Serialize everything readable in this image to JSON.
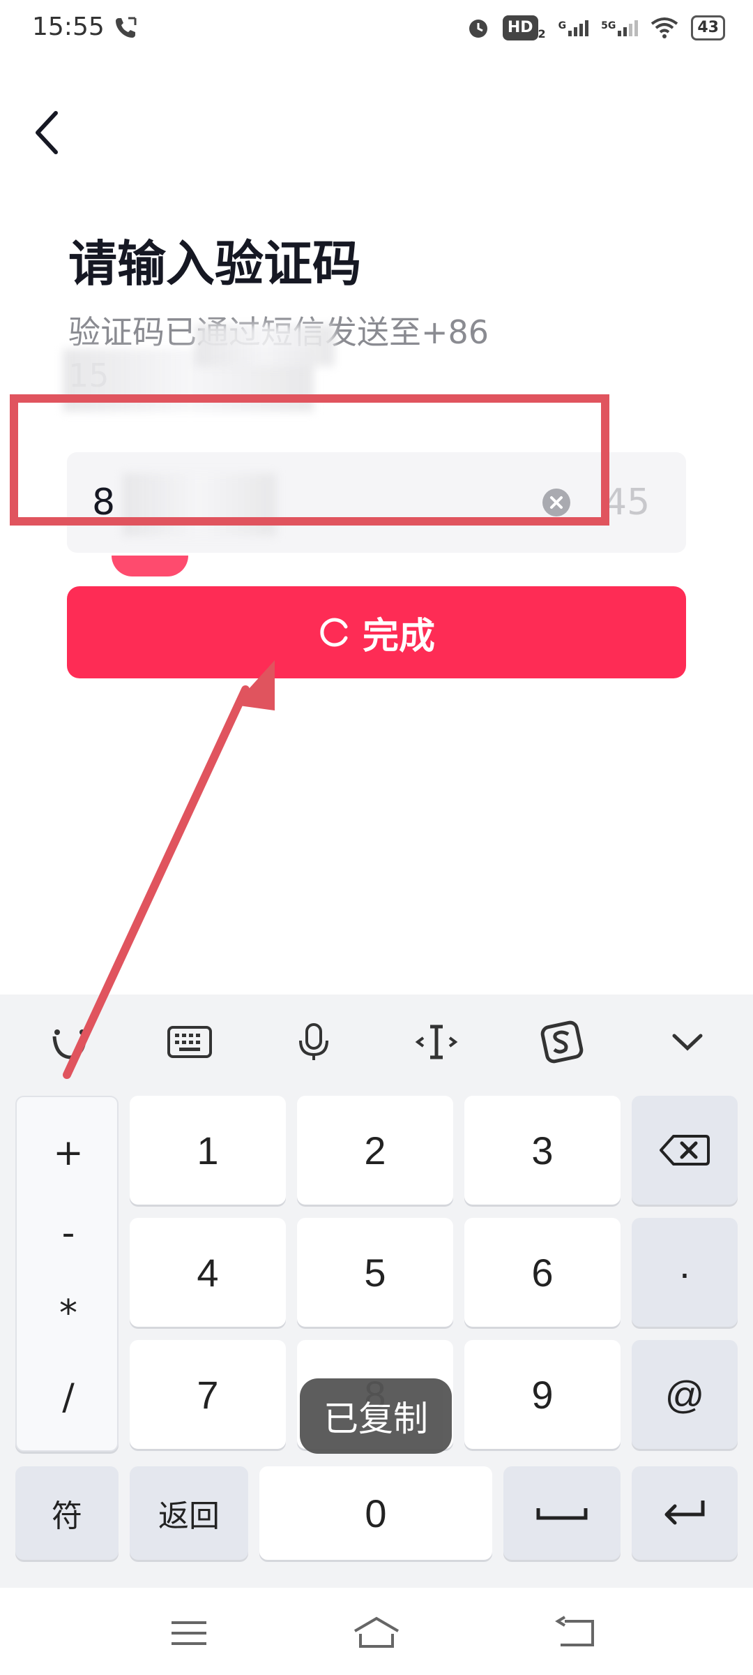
{
  "status_bar": {
    "time": "15:55",
    "hd_badge": "HD",
    "hd_sub": "2",
    "signal1_label": "G",
    "signal2_label": "5G",
    "battery": "43",
    "icons": [
      "phone-call-icon",
      "alarm-icon",
      "wifi-icon",
      "battery-icon"
    ]
  },
  "header": {
    "title": "请输入验证码",
    "subtitle_line1": "验证码已通过短信发送至+86",
    "subtitle_line2": "15"
  },
  "code_input": {
    "value": "8",
    "countdown": "45"
  },
  "done_button": {
    "label": "完成"
  },
  "keyboard": {
    "toolbar": [
      "emoji-icon",
      "keyboard-icon",
      "microphone-icon",
      "cursor-icon",
      "sogou-icon",
      "collapse-chevron-icon"
    ],
    "symbols": [
      "+",
      "-",
      "*",
      "/"
    ],
    "digits": [
      "1",
      "2",
      "3",
      "4",
      "5",
      "6",
      "7",
      "8",
      "9",
      "0"
    ],
    "dot": "·",
    "at": "@",
    "symbol_key": "符",
    "return_key": "返回"
  },
  "toast": {
    "text": "已复制"
  },
  "colors": {
    "accent": "#fe2c55",
    "annotation": "#e0545e"
  }
}
